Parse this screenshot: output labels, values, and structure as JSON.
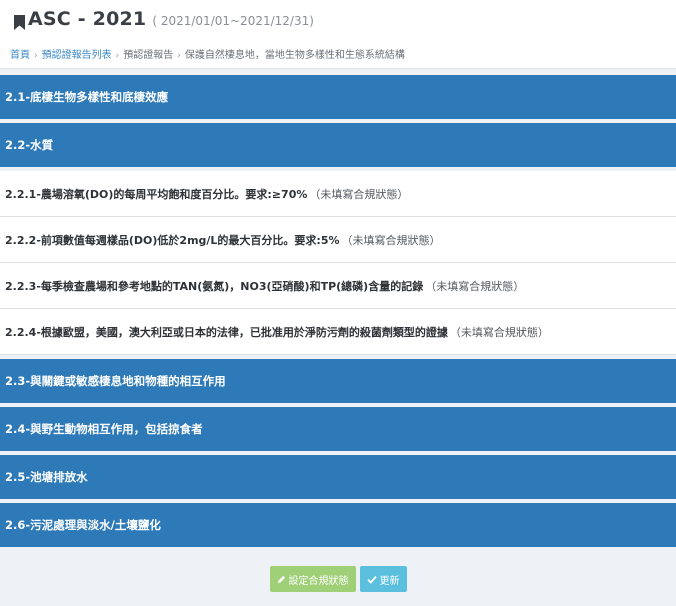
{
  "header": {
    "title": "ASC - 2021",
    "date_range": "( 2021/01/01~2021/12/31)"
  },
  "breadcrumb": {
    "home": "首頁",
    "report_list": "預認證報告列表",
    "report": "預認證報告",
    "current": "保護自然棲息地，當地生物多樣性和生態系統結構"
  },
  "sections": {
    "s21": "2.1-底棲生物多樣性和底棲效應",
    "s22": "2.2-水質",
    "s23": "2.3-與關鍵或敏感棲息地和物種的相互作用",
    "s24": "2.4-與野生動物相互作用，包括掠食者",
    "s25": "2.5-池塘排放水",
    "s26": "2.6-污泥處理與淡水/土壤鹽化"
  },
  "items": [
    {
      "text": "2.2.1-農場溶氧(DO)的每周平均飽和度百分比。要求:≥70%",
      "status": "（未填寫合規狀態）"
    },
    {
      "text": "2.2.2-前項數值每週樣品(DO)低於2mg/L的最大百分比。要求:5%",
      "status": "（未填寫合規狀態）"
    },
    {
      "text": "2.2.3-每季檢查農場和參考地點的TAN(氨氮)，NO3(亞硝酸)和TP(總磷)含量的記錄",
      "status": "（未填寫合規狀態）"
    },
    {
      "text": "2.2.4-根據歐盟，美國，澳大利亞或日本的法律，已批准用於淨防污劑的殺菌劑類型的證據",
      "status": "（未填寫合規狀態）"
    }
  ],
  "buttons": {
    "set_status": "設定合規狀態",
    "update": "更新"
  },
  "icons": {
    "title": "bookmark-icon",
    "set_status": "pencil-icon",
    "update": "check-icon"
  },
  "colors": {
    "section_bg": "#2e7ab8",
    "link": "#3b89c9",
    "btn_status": "#9bcf71",
    "btn_update": "#5bc0de"
  }
}
